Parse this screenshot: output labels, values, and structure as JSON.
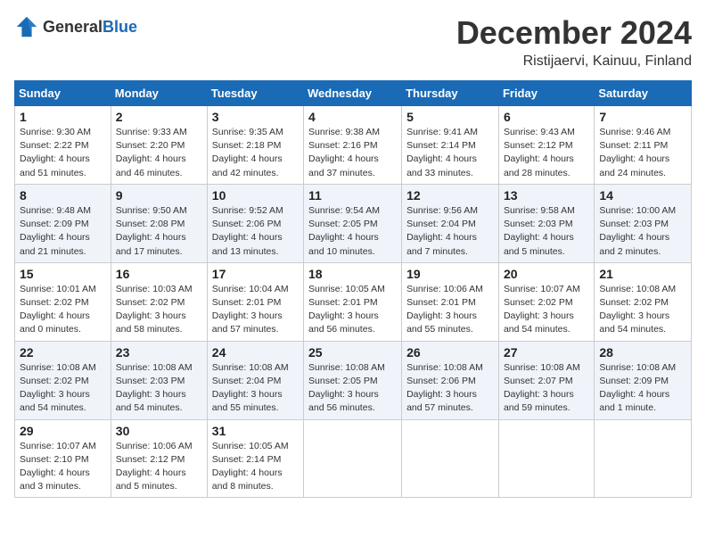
{
  "header": {
    "logo_general": "General",
    "logo_blue": "Blue",
    "month_year": "December 2024",
    "location": "Ristijaervi, Kainuu, Finland"
  },
  "days_of_week": [
    "Sunday",
    "Monday",
    "Tuesday",
    "Wednesday",
    "Thursday",
    "Friday",
    "Saturday"
  ],
  "weeks": [
    [
      {
        "day": "1",
        "info": "Sunrise: 9:30 AM\nSunset: 2:22 PM\nDaylight: 4 hours\nand 51 minutes."
      },
      {
        "day": "2",
        "info": "Sunrise: 9:33 AM\nSunset: 2:20 PM\nDaylight: 4 hours\nand 46 minutes."
      },
      {
        "day": "3",
        "info": "Sunrise: 9:35 AM\nSunset: 2:18 PM\nDaylight: 4 hours\nand 42 minutes."
      },
      {
        "day": "4",
        "info": "Sunrise: 9:38 AM\nSunset: 2:16 PM\nDaylight: 4 hours\nand 37 minutes."
      },
      {
        "day": "5",
        "info": "Sunrise: 9:41 AM\nSunset: 2:14 PM\nDaylight: 4 hours\nand 33 minutes."
      },
      {
        "day": "6",
        "info": "Sunrise: 9:43 AM\nSunset: 2:12 PM\nDaylight: 4 hours\nand 28 minutes."
      },
      {
        "day": "7",
        "info": "Sunrise: 9:46 AM\nSunset: 2:11 PM\nDaylight: 4 hours\nand 24 minutes."
      }
    ],
    [
      {
        "day": "8",
        "info": "Sunrise: 9:48 AM\nSunset: 2:09 PM\nDaylight: 4 hours\nand 21 minutes."
      },
      {
        "day": "9",
        "info": "Sunrise: 9:50 AM\nSunset: 2:08 PM\nDaylight: 4 hours\nand 17 minutes."
      },
      {
        "day": "10",
        "info": "Sunrise: 9:52 AM\nSunset: 2:06 PM\nDaylight: 4 hours\nand 13 minutes."
      },
      {
        "day": "11",
        "info": "Sunrise: 9:54 AM\nSunset: 2:05 PM\nDaylight: 4 hours\nand 10 minutes."
      },
      {
        "day": "12",
        "info": "Sunrise: 9:56 AM\nSunset: 2:04 PM\nDaylight: 4 hours\nand 7 minutes."
      },
      {
        "day": "13",
        "info": "Sunrise: 9:58 AM\nSunset: 2:03 PM\nDaylight: 4 hours\nand 5 minutes."
      },
      {
        "day": "14",
        "info": "Sunrise: 10:00 AM\nSunset: 2:03 PM\nDaylight: 4 hours\nand 2 minutes."
      }
    ],
    [
      {
        "day": "15",
        "info": "Sunrise: 10:01 AM\nSunset: 2:02 PM\nDaylight: 4 hours\nand 0 minutes."
      },
      {
        "day": "16",
        "info": "Sunrise: 10:03 AM\nSunset: 2:02 PM\nDaylight: 3 hours\nand 58 minutes."
      },
      {
        "day": "17",
        "info": "Sunrise: 10:04 AM\nSunset: 2:01 PM\nDaylight: 3 hours\nand 57 minutes."
      },
      {
        "day": "18",
        "info": "Sunrise: 10:05 AM\nSunset: 2:01 PM\nDaylight: 3 hours\nand 56 minutes."
      },
      {
        "day": "19",
        "info": "Sunrise: 10:06 AM\nSunset: 2:01 PM\nDaylight: 3 hours\nand 55 minutes."
      },
      {
        "day": "20",
        "info": "Sunrise: 10:07 AM\nSunset: 2:02 PM\nDaylight: 3 hours\nand 54 minutes."
      },
      {
        "day": "21",
        "info": "Sunrise: 10:08 AM\nSunset: 2:02 PM\nDaylight: 3 hours\nand 54 minutes."
      }
    ],
    [
      {
        "day": "22",
        "info": "Sunrise: 10:08 AM\nSunset: 2:02 PM\nDaylight: 3 hours\nand 54 minutes."
      },
      {
        "day": "23",
        "info": "Sunrise: 10:08 AM\nSunset: 2:03 PM\nDaylight: 3 hours\nand 54 minutes."
      },
      {
        "day": "24",
        "info": "Sunrise: 10:08 AM\nSunset: 2:04 PM\nDaylight: 3 hours\nand 55 minutes."
      },
      {
        "day": "25",
        "info": "Sunrise: 10:08 AM\nSunset: 2:05 PM\nDaylight: 3 hours\nand 56 minutes."
      },
      {
        "day": "26",
        "info": "Sunrise: 10:08 AM\nSunset: 2:06 PM\nDaylight: 3 hours\nand 57 minutes."
      },
      {
        "day": "27",
        "info": "Sunrise: 10:08 AM\nSunset: 2:07 PM\nDaylight: 3 hours\nand 59 minutes."
      },
      {
        "day": "28",
        "info": "Sunrise: 10:08 AM\nSunset: 2:09 PM\nDaylight: 4 hours\nand 1 minute."
      }
    ],
    [
      {
        "day": "29",
        "info": "Sunrise: 10:07 AM\nSunset: 2:10 PM\nDaylight: 4 hours\nand 3 minutes."
      },
      {
        "day": "30",
        "info": "Sunrise: 10:06 AM\nSunset: 2:12 PM\nDaylight: 4 hours\nand 5 minutes."
      },
      {
        "day": "31",
        "info": "Sunrise: 10:05 AM\nSunset: 2:14 PM\nDaylight: 4 hours\nand 8 minutes."
      },
      null,
      null,
      null,
      null
    ]
  ]
}
